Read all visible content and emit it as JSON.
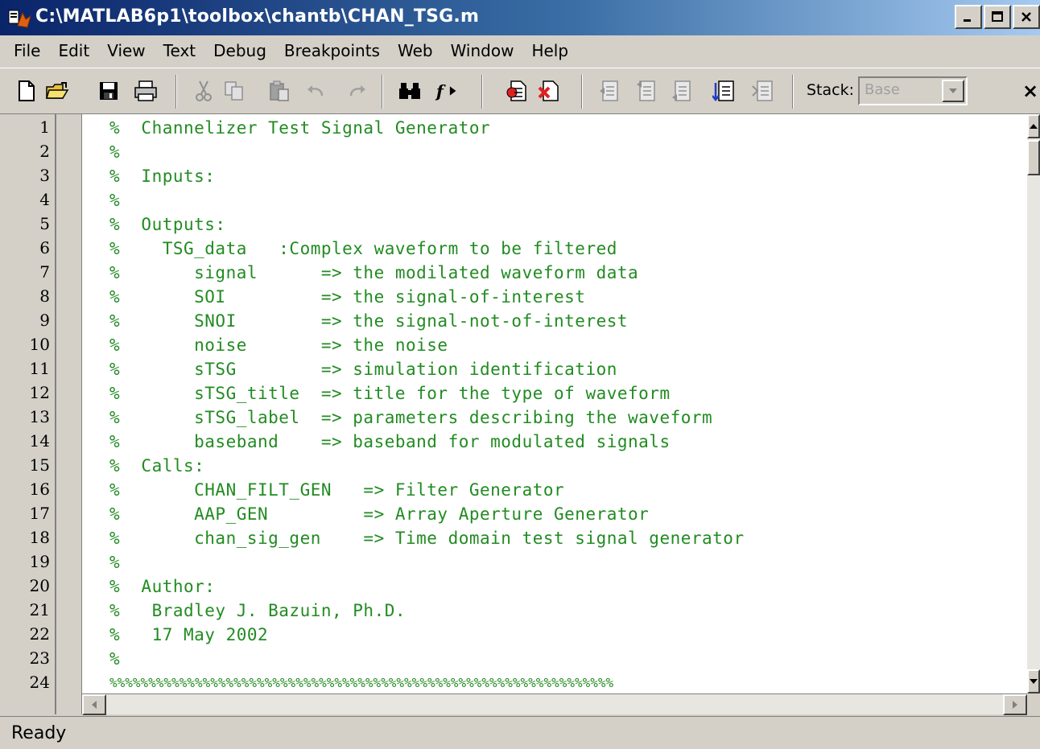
{
  "window": {
    "title": "C:\\MATLAB6p1\\toolbox\\chantb\\CHAN_TSG.m"
  },
  "menu": [
    "File",
    "Edit",
    "View",
    "Text",
    "Debug",
    "Breakpoints",
    "Web",
    "Window",
    "Help"
  ],
  "toolbar": {
    "icons": [
      "new-file-icon",
      "open-folder-icon",
      "save-icon",
      "print-icon",
      "cut-icon",
      "copy-icon",
      "paste-icon",
      "undo-icon",
      "redo-icon",
      "find-icon",
      "function-icon",
      "set-breakpoint-icon",
      "clear-breakpoint-icon",
      "step-icon",
      "step-in-icon",
      "step-out-icon",
      "continue-icon",
      "exit-debug-icon"
    ],
    "stack_label": "Stack:",
    "stack_value": "Base",
    "close_symbol": "×"
  },
  "editor": {
    "lines": [
      "%  Channelizer Test Signal Generator",
      "%",
      "%  Inputs:",
      "%",
      "%  Outputs:",
      "%    TSG_data   :Complex waveform to be filtered",
      "%       signal      => the modilated waveform data",
      "%       SOI         => the signal-of-interest",
      "%       SNOI        => the signal-not-of-interest",
      "%       noise       => the noise",
      "%       sTSG        => simulation identification",
      "%       sTSG_title  => title for the type of waveform",
      "%       sTSG_label  => parameters describing the waveform",
      "%       baseband    => baseband for modulated signals",
      "%  Calls:",
      "%       CHAN_FILT_GEN   => Filter Generator",
      "%       AAP_GEN         => Array Aperture Generator",
      "%       chan_sig_gen    => Time domain test signal generator",
      "%",
      "%  Author:",
      "%   Bradley J. Bazuin, Ph.D.",
      "%   17 May 2002",
      "%",
      "%%%%%%%%%%%%%%%%%%%%%%%%%%%%%%%%%%%%%%%%%%%%%%%%%%%%%%%%%%%%%%%%%"
    ]
  },
  "status": {
    "text": "Ready"
  },
  "colors": {
    "comment": "#228b22",
    "chrome": "#d4d0c8",
    "title_start": "#0a246a"
  }
}
